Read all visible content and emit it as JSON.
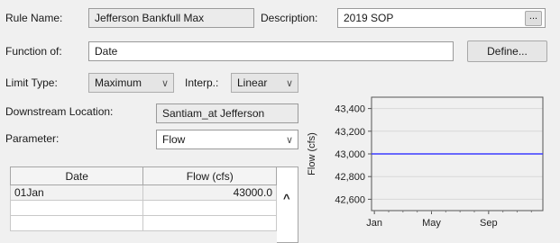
{
  "form": {
    "rule_name_label": "Rule Name:",
    "rule_name_value": "Jefferson Bankfull Max",
    "description_label": "Description:",
    "description_value": "2019 SOP",
    "description_button": "...",
    "function_of_label": "Function of:",
    "function_of_value": "Date",
    "define_button": "Define...",
    "limit_type_label": "Limit Type:",
    "limit_type_value": "Maximum",
    "interp_label": "Interp.:",
    "interp_value": "Linear",
    "downstream_label": "Downstream Location:",
    "downstream_value": "Santiam_at Jefferson",
    "parameter_label": "Parameter:",
    "parameter_value": "Flow"
  },
  "table": {
    "headers": [
      "Date",
      "Flow (cfs)"
    ],
    "rows": [
      {
        "date": "01Jan",
        "flow": "43000.0"
      },
      {
        "date": "",
        "flow": ""
      },
      {
        "date": "",
        "flow": ""
      }
    ],
    "scroll_up_glyph": "^"
  },
  "chart_data": {
    "type": "line",
    "xlabel": "",
    "ylabel": "Flow (cfs)",
    "x_tick_labels": [
      "Jan",
      "May",
      "Sep"
    ],
    "y_tick_labels": [
      "43,400",
      "43,200",
      "43,000",
      "42,800",
      "42,600"
    ],
    "y_ticks": [
      43400,
      43200,
      43000,
      42800,
      42600
    ],
    "ylim": [
      42500,
      43500
    ],
    "series": [
      {
        "values": [
          43000,
          43000
        ],
        "x": [
          "Jan",
          "Dec"
        ]
      }
    ],
    "line_color": "#3a3aff",
    "grid": true
  }
}
